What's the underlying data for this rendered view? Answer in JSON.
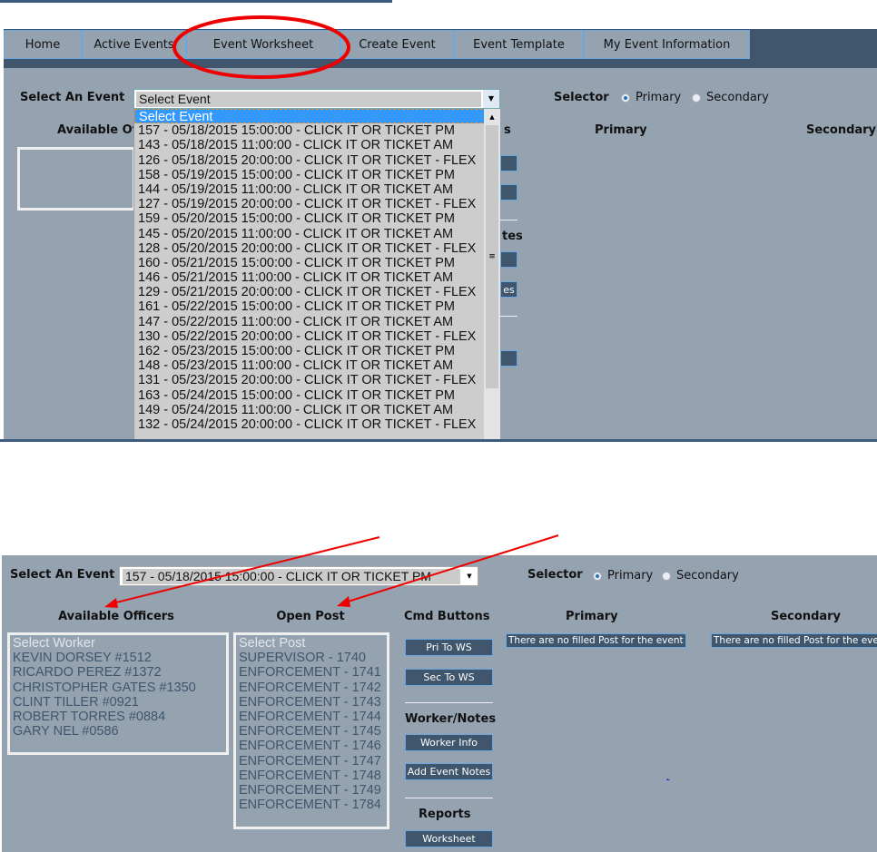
{
  "nav": {
    "tabs": [
      "Home",
      "Active Events",
      "Event Worksheet",
      "Create Event",
      "Event Template",
      "My Event Information"
    ]
  },
  "top": {
    "select_label": "Select An Event",
    "select_value": "Select Event",
    "selector_label": "Selector",
    "primary": "Primary",
    "secondary": "Secondary",
    "available_partial": "Available Of",
    "primary_hdr": "Primary",
    "secondary_hdr": "Secondary",
    "partial_s": "s",
    "partial_tes": "tes",
    "partial_es": "es",
    "options": [
      "Select Event",
      "157 - 05/18/2015 15:00:00 - CLICK IT OR TICKET PM",
      "143 - 05/18/2015 11:00:00 - CLICK IT OR TICKET AM",
      "126 - 05/18/2015 20:00:00 - CLICK IT OR TICKET - FLEX",
      "158 - 05/19/2015 15:00:00 - CLICK IT OR TICKET PM",
      "144 - 05/19/2015 11:00:00 - CLICK IT OR TICKET AM",
      "127 - 05/19/2015 20:00:00 - CLICK IT OR TICKET - FLEX",
      "159 - 05/20/2015 15:00:00 - CLICK IT OR TICKET PM",
      "145 - 05/20/2015 11:00:00 - CLICK IT OR TICKET AM",
      "128 - 05/20/2015 20:00:00 - CLICK IT OR TICKET - FLEX",
      "160 - 05/21/2015 15:00:00 - CLICK IT OR TICKET PM",
      "146 - 05/21/2015 11:00:00 - CLICK IT OR TICKET AM",
      "129 - 05/21/2015 20:00:00 - CLICK IT OR TICKET - FLEX",
      "161 - 05/22/2015 15:00:00 - CLICK IT OR TICKET PM",
      "147 - 05/22/2015 11:00:00 - CLICK IT OR TICKET AM",
      "130 - 05/22/2015 20:00:00 - CLICK IT OR TICKET - FLEX",
      "162 - 05/23/2015 15:00:00 - CLICK IT OR TICKET PM",
      "148 - 05/23/2015 11:00:00 - CLICK IT OR TICKET AM",
      "131 - 05/23/2015 20:00:00 - CLICK IT OR TICKET - FLEX",
      "163 - 05/24/2015 15:00:00 - CLICK IT OR TICKET PM",
      "149 - 05/24/2015 11:00:00 - CLICK IT OR TICKET AM",
      "132 - 05/24/2015 20:00:00 - CLICK IT OR TICKET - FLEX"
    ]
  },
  "bottom": {
    "select_label": "Select An Event",
    "select_value": "157 - 05/18/2015 15:00:00 - CLICK IT OR TICKET PM",
    "selector_label": "Selector",
    "primary": "Primary",
    "secondary": "Secondary",
    "available_hdr": "Available Officers",
    "openpost_hdr": "Open Post",
    "cmd_hdr": "Cmd Buttons",
    "primary_hdr": "Primary",
    "secondary_hdr": "Secondary",
    "workers": [
      "Select Worker",
      "KEVIN DORSEY #1512",
      "RICARDO PEREZ #1372",
      "CHRISTOPHER GATES #1350",
      "CLINT TILLER #0921",
      "ROBERT TORRES #0884",
      "GARY NEL #0586"
    ],
    "posts": [
      "Select Post",
      "SUPERVISOR - 1740",
      "ENFORCEMENT - 1741",
      "ENFORCEMENT - 1742",
      "ENFORCEMENT - 1743",
      "ENFORCEMENT - 1744",
      "ENFORCEMENT - 1745",
      "ENFORCEMENT - 1746",
      "ENFORCEMENT - 1747",
      "ENFORCEMENT - 1748",
      "ENFORCEMENT - 1749",
      "ENFORCEMENT - 1784"
    ],
    "pri_to_ws": "Pri To WS",
    "sec_to_ws": "Sec To WS",
    "worker_notes_hdr": "Worker/Notes",
    "worker_info": "Worker Info",
    "add_notes": "Add Event Notes",
    "reports_hdr": "Reports",
    "worksheet": "Worksheet",
    "empty_primary": "There are no filled Post for the event",
    "empty_secondary": "There are no filled Post for the event"
  }
}
